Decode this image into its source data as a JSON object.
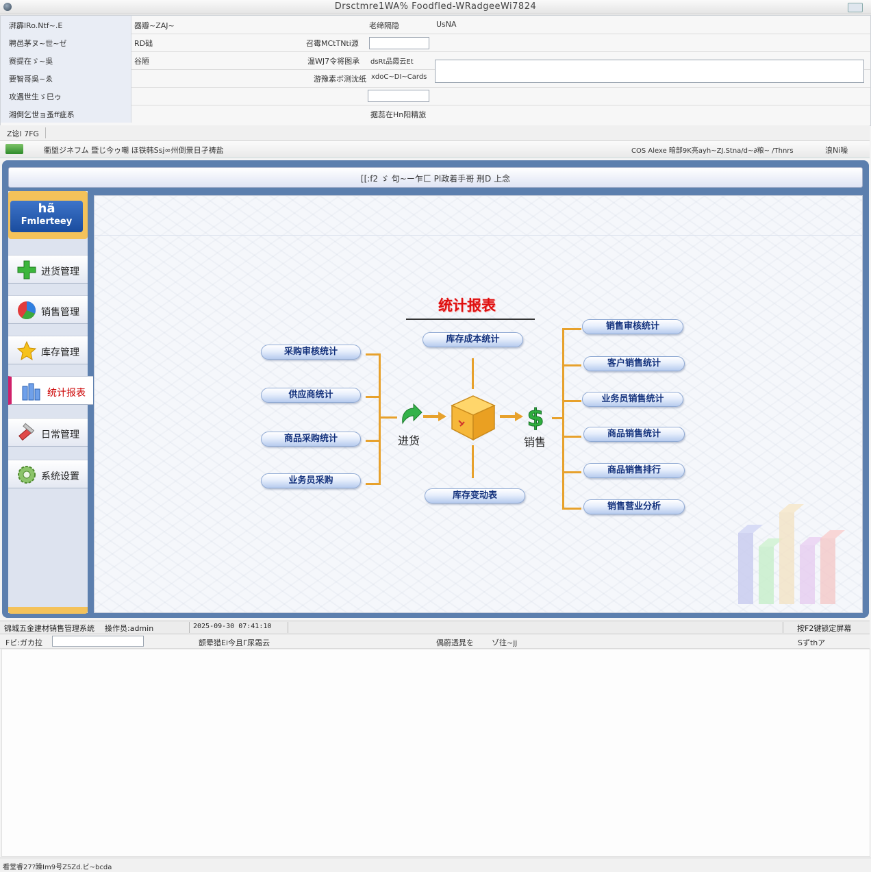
{
  "window": {
    "title": "Drsctmre1WA% Foodfled-WRadgeeWi7824"
  },
  "form": {
    "rows": [
      {
        "label": "湃霹lRo.Ntf~.E",
        "value": "器瓣~ZAJ~",
        "mid_label": "",
        "right_label": "老缔隔隐",
        "right_value": "UsNA"
      },
      {
        "label": "聘邑茅ヌ~世~ゼ",
        "value": "RD础",
        "mid_label": "召霉MCtTNti源",
        "right_label": "",
        "right_value": ""
      },
      {
        "label": "赛提在ゞ~吳",
        "value": "谷陋",
        "mid_label": "温WJ7令将图承",
        "right_label": "",
        "right_value": "dsRt品霞云Et"
      },
      {
        "label": "要智哥吳~ゑ",
        "value": "",
        "mid_label": "游豫素ボ测沈纸",
        "right_label": "",
        "right_value": "xdoC~DI~Cards"
      },
      {
        "label": "攻遇世生ゞ巳ゥ",
        "value": "",
        "mid_label": "",
        "right_label": "",
        "right_value": ""
      },
      {
        "label": "湘倒乞世ョ蚤ff疵系",
        "value": "",
        "mid_label": "",
        "right_label": "据蕊在Hn阳精旅",
        "right_value": ""
      }
    ]
  },
  "strip1": {
    "text": "Z谂l 7FG"
  },
  "strip2": {
    "left_text": "衢盥ジネフム 暨じ今ゥ嘲 ほ铁韩Ssj∞州倒景日孑祷盐",
    "right_text": "COS Alexe 暗部9K亮ayh~ZJ.Stna/d~∂粮~ /Thnrs",
    "right_btn": "浪Ni噪"
  },
  "header": {
    "title": "[[:f2 ゞ 句~ー乍匚 Pl政着手哥 刑D 上念"
  },
  "logo": {
    "line1": "hã",
    "line2": "Fmlerteey"
  },
  "nav": {
    "purchase": "进货管理",
    "sales": "销售管理",
    "inventory": "库存管理",
    "reports": "统计报表",
    "daily": "日常管理",
    "settings": "系统设置"
  },
  "diagram": {
    "title": "统计报表",
    "left_buttons": [
      "采购审核统计",
      "供应商统计",
      "商品采购统计",
      "业务员采购"
    ],
    "top_button": "库存成本统计",
    "bottom_button": "库存变动表",
    "right_buttons": [
      "销售审核统计",
      "客户销售统计",
      "业务员销售统计",
      "商品销售统计",
      "商品销售排行",
      "销售营业分析"
    ],
    "flow_in": "进货",
    "flow_out": "销售"
  },
  "status": {
    "system": "锦城五金建材销售管理系统",
    "operator": "操作员:admin",
    "datetime": "2025-09-30 07:41:10",
    "hint": "按F2键锁定屏幕"
  },
  "lowerbar": {
    "left_label": "Fビ:ガカ拉",
    "input_value": "",
    "mid_text": "颤晕猎Ei今且Γ尿霜云",
    "mid2_text": "偶蔚透晁を",
    "mid2_value": "ゾ往~jj",
    "right_text": "Sずthア"
  },
  "footer": {
    "text": "看堂睿27?躁Im9号Z5Zd.ビ~bcda"
  }
}
